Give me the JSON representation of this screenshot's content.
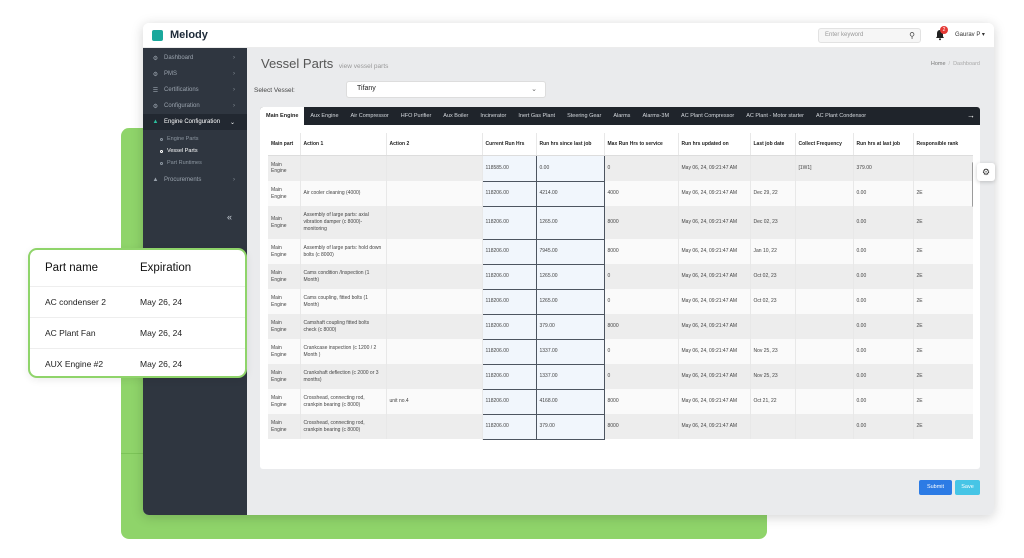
{
  "app": {
    "name": "Melody"
  },
  "topbar": {
    "search_placeholder": "Enter keyword",
    "notification_count": "2",
    "user_name": "Gaurav P"
  },
  "sidebar": {
    "items": [
      {
        "label": "Dashboard",
        "icon": "dashboard-icon"
      },
      {
        "label": "PMS",
        "icon": "gears-icon"
      },
      {
        "label": "Certifications",
        "icon": "list-icon"
      },
      {
        "label": "Configuration",
        "icon": "cog-icon"
      },
      {
        "label": "Engine Configuration",
        "icon": "tree-icon"
      },
      {
        "label": "Procurements",
        "icon": "tree-icon"
      }
    ],
    "sub_items": [
      {
        "label": "Engine Parts"
      },
      {
        "label": "Vessel Parts"
      },
      {
        "label": "Part Runtimes"
      }
    ],
    "collapse_glyph": "«"
  },
  "page": {
    "title": "Vessel Parts",
    "subtitle": "view vessel parts",
    "breadcrumb_home": "Home",
    "breadcrumb_sep": "/",
    "breadcrumb_current": "Dashboard",
    "select_vessel_label": "Select Vessel:",
    "selected_vessel": "Tifany"
  },
  "tabs": [
    "Main Engine",
    "Aux Engine",
    "Air Compressor",
    "HFO Purifier",
    "Aux Boiler",
    "Incinerator",
    "Inert Gas Plant",
    "Steering Gear",
    "Alarms",
    "Alarms-3M",
    "AC Plant Compressor",
    "AC Plant - Motor starter",
    "AC Plant Condensor"
  ],
  "tab_next": "→",
  "table": {
    "headers": [
      "Main part",
      "Action 1",
      "Action 2",
      "Current Run Hrs",
      "Run hrs since last job",
      "Max Run Hrs to service",
      "Run hrs updated on",
      "Last job date",
      "Collect Frequency",
      "Run hrs at last job",
      "Responsible rank"
    ],
    "rows": [
      [
        "Main Engine",
        "",
        "",
        "118585.00",
        "0.00",
        "0",
        "May 06, 24, 09:21:47 AM",
        "",
        "[1W1]",
        "379.00",
        ""
      ],
      [
        "Main Engine",
        "Air cooler cleaning (4000)",
        "",
        "118206.00",
        "4214.00",
        "4000",
        "May 06, 24, 09:21:47 AM",
        "Dec 29, 22",
        "",
        "0.00",
        "2E"
      ],
      [
        "Main Engine",
        "Assembly of large parts: axial vibration damper (c 8000)- monitoring",
        "",
        "118206.00",
        "1265.00",
        "8000",
        "May 06, 24, 09:21:47 AM",
        "Dec 02, 23",
        "",
        "0.00",
        "2E"
      ],
      [
        "Main Engine",
        "Assembly of large parts: hold down bolts (c 8000)",
        "",
        "118206.00",
        "7945.00",
        "8000",
        "May 06, 24, 09:21:47 AM",
        "Jan 10, 22",
        "",
        "0.00",
        "2E"
      ],
      [
        "Main Engine",
        "Cams condition /Inspection (1 Month)",
        "",
        "118206.00",
        "1265.00",
        "0",
        "May 06, 24, 09:21:47 AM",
        "Oct 02, 23",
        "",
        "0.00",
        "2E"
      ],
      [
        "Main Engine",
        "Cams coupling, fitted bolts (1 Month)",
        "",
        "118206.00",
        "1265.00",
        "0",
        "May 06, 24, 09:21:47 AM",
        "Oct 02, 23",
        "",
        "0.00",
        "2E"
      ],
      [
        "Main Engine",
        "Camshaft coupling fitted bolts check (c 8000)",
        "",
        "118206.00",
        "379.00",
        "8000",
        "May 06, 24, 09:21:47 AM",
        "",
        "",
        "0.00",
        "2E"
      ],
      [
        "Main Engine",
        "Crankcase inspection (c 1200 / 2 Month )",
        "",
        "118206.00",
        "1337.00",
        "0",
        "May 06, 24, 09:21:47 AM",
        "Nov 25, 23",
        "",
        "0.00",
        "2E"
      ],
      [
        "Main Engine",
        "Crankshaft deflection (c 2000 or 3 months)",
        "",
        "118206.00",
        "1337.00",
        "0",
        "May 06, 24, 09:21:47 AM",
        "Nov 25, 23",
        "",
        "0.00",
        "2E"
      ],
      [
        "Main Engine",
        "Crosshead, connecting rod, crankpin bearing (c 8000)",
        "unit no.4",
        "118206.00",
        "4168.00",
        "8000",
        "May 06, 24, 09:21:47 AM",
        "Oct 21, 22",
        "",
        "0.00",
        "2E"
      ],
      [
        "Main Engine",
        "Crosshead, connecting rod, crankpin bearing (c 8000)",
        "",
        "118206.00",
        "379.00",
        "8000",
        "May 06, 24, 09:21:47 AM",
        "",
        "",
        "0.00",
        "2E"
      ]
    ]
  },
  "buttons": {
    "submit": "Submit",
    "save": "Save"
  },
  "popup": {
    "headers": [
      "Part name",
      "Expiration"
    ],
    "rows": [
      [
        "AC condenser 2",
        "May 26, 24"
      ],
      [
        "AC Plant Fan",
        "May 26, 24"
      ],
      [
        "AUX Engine #2",
        "May 26, 24"
      ]
    ]
  },
  "colors": {
    "accent": "#1aa89c",
    "sidebar": "#2f3640",
    "tabbar": "#1f242b",
    "submit": "#2c7be5",
    "save": "#46c5e6",
    "backdrop": "#8fd46a"
  }
}
